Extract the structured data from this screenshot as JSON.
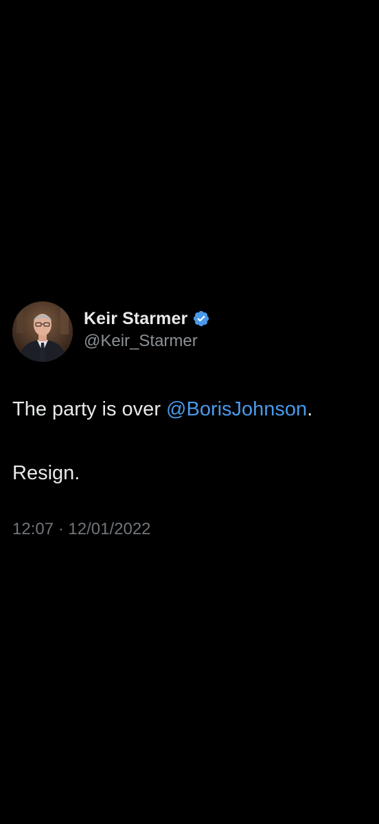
{
  "author": {
    "display_name": "Keir Starmer",
    "handle": "@Keir_Starmer",
    "verified_badge_icon": "verified-badge-icon",
    "badge_color": "#4a99e9"
  },
  "tweet": {
    "text_prefix": "The party is over ",
    "mention": "@BorisJohnson",
    "text_suffix": ".",
    "line2": "Resign.",
    "time": "12:07",
    "separator": " · ",
    "date": "12/01/2022"
  },
  "colors": {
    "background": "#000000",
    "text": "#e7e9ea",
    "secondary_text": "#71767b",
    "link": "#4a99e9"
  }
}
